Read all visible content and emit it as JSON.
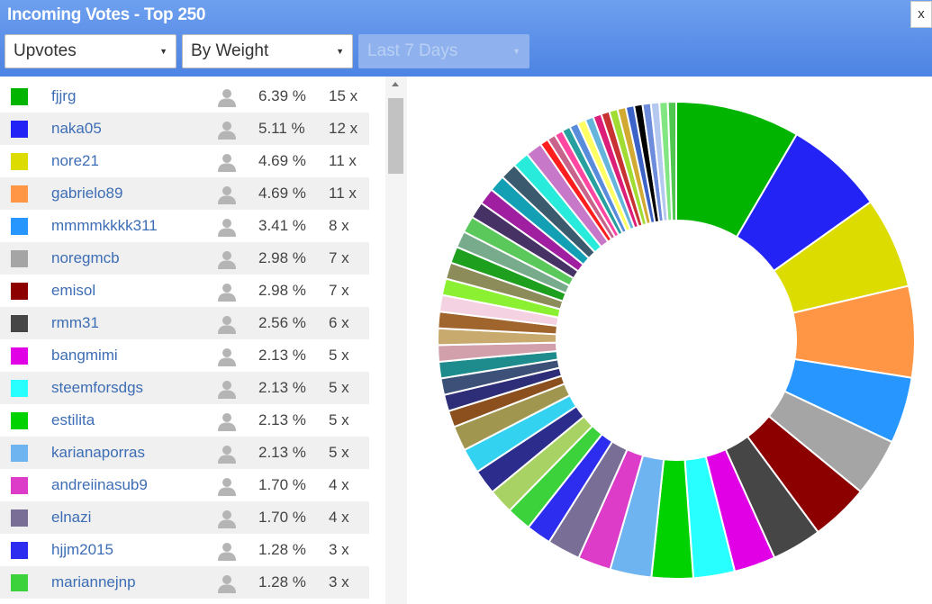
{
  "header": {
    "title": "Incoming Votes - Top 250",
    "close_label": "x",
    "filters": {
      "type": "Upvotes",
      "mode": "By Weight",
      "range": "Last 7 Days"
    }
  },
  "icons": {
    "close": "close-icon",
    "dropdown": "caret-down-icon",
    "user": "user-avatar-icon",
    "scroll_up": "arrow-up-icon"
  },
  "voters": [
    {
      "name": "fjjrg",
      "percent": "6.39 %",
      "count": "15 x",
      "color": "#00b400"
    },
    {
      "name": "naka05",
      "percent": "5.11 %",
      "count": "12 x",
      "color": "#2323f5"
    },
    {
      "name": "nore21",
      "percent": "4.69 %",
      "count": "11 x",
      "color": "#dcdc00"
    },
    {
      "name": "gabrielo89",
      "percent": "4.69 %",
      "count": "11 x",
      "color": "#ff9646"
    },
    {
      "name": "mmmmkkkk311",
      "percent": "3.41 %",
      "count": "8 x",
      "color": "#2896ff"
    },
    {
      "name": "noregmcb",
      "percent": "2.98 %",
      "count": "7 x",
      "color": "#a5a5a5"
    },
    {
      "name": "emisol",
      "percent": "2.98 %",
      "count": "7 x",
      "color": "#8c0000"
    },
    {
      "name": "rmm31",
      "percent": "2.56 %",
      "count": "6 x",
      "color": "#464646"
    },
    {
      "name": "bangmimi",
      "percent": "2.13 %",
      "count": "5 x",
      "color": "#e100e6"
    },
    {
      "name": "steemforsdgs",
      "percent": "2.13 %",
      "count": "5 x",
      "color": "#28ffff"
    },
    {
      "name": "estilita",
      "percent": "2.13 %",
      "count": "5 x",
      "color": "#00d200"
    },
    {
      "name": "karianaporras",
      "percent": "2.13 %",
      "count": "5 x",
      "color": "#6eb4f0"
    },
    {
      "name": "andreiinasub9",
      "percent": "1.70 %",
      "count": "4 x",
      "color": "#dc3cc8"
    },
    {
      "name": "elnazi",
      "percent": "1.70 %",
      "count": "4 x",
      "color": "#786e96"
    },
    {
      "name": "hjjm2015",
      "percent": "1.28 %",
      "count": "3 x",
      "color": "#2d2df0"
    },
    {
      "name": "mariannejnp",
      "percent": "1.28 %",
      "count": "3 x",
      "color": "#3cd23c"
    }
  ],
  "chart_data": {
    "type": "pie",
    "style": "donut",
    "legend": "none",
    "slices": [
      {
        "label": "fjjrg",
        "value": 6.39,
        "color": "#00b400"
      },
      {
        "label": "naka05",
        "value": 5.11,
        "color": "#2323f5"
      },
      {
        "label": "nore21",
        "value": 4.69,
        "color": "#dcdc00"
      },
      {
        "label": "gabrielo89",
        "value": 4.69,
        "color": "#ff9646"
      },
      {
        "label": "mmmmkkkk311",
        "value": 3.41,
        "color": "#2896ff"
      },
      {
        "label": "noregmcb",
        "value": 2.98,
        "color": "#a5a5a5"
      },
      {
        "label": "emisol",
        "value": 2.98,
        "color": "#8c0000"
      },
      {
        "label": "rmm31",
        "value": 2.56,
        "color": "#464646"
      },
      {
        "label": "bangmimi",
        "value": 2.13,
        "color": "#e100e6"
      },
      {
        "label": "steemforsdgs",
        "value": 2.13,
        "color": "#28ffff"
      },
      {
        "label": "estilita",
        "value": 2.13,
        "color": "#00d200"
      },
      {
        "label": "karianaporras",
        "value": 2.13,
        "color": "#6eb4f0"
      },
      {
        "label": "andreiinasub9",
        "value": 1.7,
        "color": "#dc3cc8"
      },
      {
        "label": "elnazi",
        "value": 1.7,
        "color": "#786e96"
      },
      {
        "label": "hjjm2015",
        "value": 1.28,
        "color": "#2d2df0"
      },
      {
        "label": "mariannejnp",
        "value": 1.28,
        "color": "#3cd23c"
      },
      {
        "label": "",
        "value": 1.28,
        "color": "#a8d264"
      },
      {
        "label": "",
        "value": 1.28,
        "color": "#2c2c8c"
      },
      {
        "label": "",
        "value": 1.28,
        "color": "#32d2f0"
      },
      {
        "label": "",
        "value": 1.28,
        "color": "#a09650"
      },
      {
        "label": "",
        "value": 0.85,
        "color": "#8c501e"
      },
      {
        "label": "",
        "value": 0.85,
        "color": "#2d2d78"
      },
      {
        "label": "",
        "value": 0.85,
        "color": "#3c5078"
      },
      {
        "label": "",
        "value": 0.85,
        "color": "#1e8c8c"
      },
      {
        "label": "",
        "value": 0.85,
        "color": "#d2a0aa"
      },
      {
        "label": "",
        "value": 0.85,
        "color": "#c8aa6e"
      },
      {
        "label": "",
        "value": 0.85,
        "color": "#a0642d"
      },
      {
        "label": "",
        "value": 0.85,
        "color": "#f5d2e1"
      },
      {
        "label": "",
        "value": 0.85,
        "color": "#8cf032"
      },
      {
        "label": "",
        "value": 0.85,
        "color": "#8c8c5a"
      },
      {
        "label": "",
        "value": 0.85,
        "color": "#1ea01e"
      },
      {
        "label": "",
        "value": 0.85,
        "color": "#78aa8c"
      },
      {
        "label": "",
        "value": 0.85,
        "color": "#5ac85a"
      },
      {
        "label": "",
        "value": 0.85,
        "color": "#463264"
      },
      {
        "label": "",
        "value": 0.85,
        "color": "#a01ea0"
      },
      {
        "label": "",
        "value": 0.85,
        "color": "#14a0b4"
      },
      {
        "label": "",
        "value": 0.85,
        "color": "#3c5a6e"
      },
      {
        "label": "",
        "value": 0.85,
        "color": "#28ebdc"
      },
      {
        "label": "",
        "value": 0.85,
        "color": "#c878c8"
      },
      {
        "label": "",
        "value": 0.43,
        "color": "#ff1e1e"
      },
      {
        "label": "",
        "value": 0.43,
        "color": "#c8648c"
      },
      {
        "label": "",
        "value": 0.43,
        "color": "#ff46a0"
      },
      {
        "label": "",
        "value": 0.43,
        "color": "#28a0a0"
      },
      {
        "label": "",
        "value": 0.43,
        "color": "#5a8cdc"
      },
      {
        "label": "",
        "value": 0.43,
        "color": "#ffff64"
      },
      {
        "label": "",
        "value": 0.43,
        "color": "#64b4dc"
      },
      {
        "label": "",
        "value": 0.43,
        "color": "#dc1e78"
      },
      {
        "label": "",
        "value": 0.43,
        "color": "#c83232"
      },
      {
        "label": "",
        "value": 0.43,
        "color": "#a0dc32"
      },
      {
        "label": "",
        "value": 0.43,
        "color": "#d2aa32"
      },
      {
        "label": "",
        "value": 0.43,
        "color": "#3c64c8"
      },
      {
        "label": "",
        "value": 0.43,
        "color": "#000000"
      },
      {
        "label": "",
        "value": 0.43,
        "color": "#6e8cdc"
      },
      {
        "label": "",
        "value": 0.43,
        "color": "#b4c8f0"
      },
      {
        "label": "",
        "value": 0.43,
        "color": "#82e682"
      },
      {
        "label": "",
        "value": 0.43,
        "color": "#50c850"
      }
    ]
  }
}
